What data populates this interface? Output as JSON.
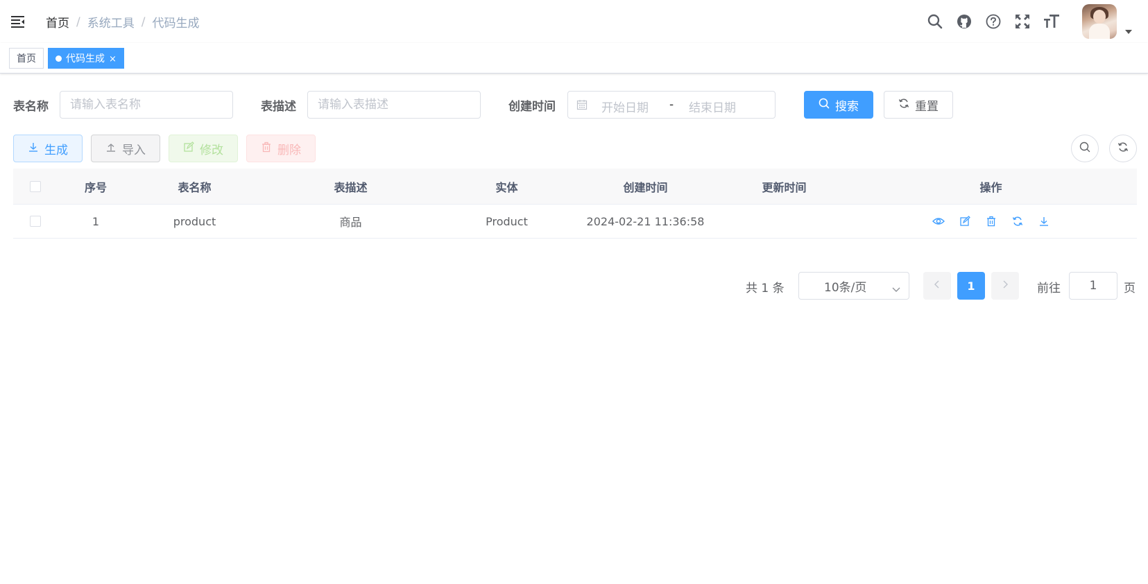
{
  "navbar": {
    "breadcrumb": [
      "首页",
      "系统工具",
      "代码生成"
    ],
    "separator": "/",
    "icons": [
      "search-icon",
      "github-icon",
      "help-icon",
      "fullscreen-icon",
      "font-size-icon"
    ]
  },
  "tags": [
    {
      "label": "首页",
      "active": false
    },
    {
      "label": "代码生成",
      "active": true,
      "close": "×"
    }
  ],
  "search": {
    "table_name_label": "表名称",
    "table_name_placeholder": "请输入表名称",
    "table_desc_label": "表描述",
    "table_desc_placeholder": "请输入表描述",
    "create_time_label": "创建时间",
    "start_placeholder": "开始日期",
    "range_separator": "-",
    "end_placeholder": "结束日期",
    "search_button": "搜索",
    "reset_button": "重置"
  },
  "toolbar": {
    "generate": "生成",
    "import": "导入",
    "edit": "修改",
    "delete": "删除"
  },
  "table": {
    "columns": [
      "序号",
      "表名称",
      "表描述",
      "实体",
      "创建时间",
      "更新时间",
      "操作"
    ],
    "rows": [
      {
        "index": "1",
        "table_name": "product",
        "table_desc": "商品",
        "entity": "Product",
        "create_time": "2024-02-21 11:36:58",
        "update_time": ""
      }
    ],
    "row_actions": [
      "preview-icon",
      "edit-icon",
      "delete-icon",
      "sync-icon",
      "download-icon"
    ]
  },
  "pagination": {
    "total": "共 1 条",
    "page_size": "10条/页",
    "current_page": "1",
    "goto_label": "前往",
    "goto_value": "1",
    "page_unit": "页"
  },
  "colors": {
    "primary": "#409eff",
    "success_light": "#b3e19d",
    "danger_light": "#f9b8b8"
  }
}
